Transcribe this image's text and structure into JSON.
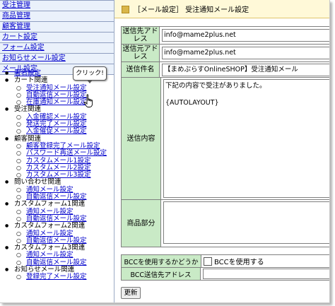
{
  "nav": {
    "items": [
      "受注管理",
      "商品管理",
      "顧客管理",
      "カート設定",
      "フォーム設定",
      "お知らせメール設定",
      "メール設定"
    ]
  },
  "tree": {
    "groups": [
      {
        "label": "署名設定",
        "children": []
      },
      {
        "label": "カート関連",
        "children": [
          "受注通知メール設定",
          "自動返信メール設定",
          "在庫通知メール設定"
        ]
      },
      {
        "label": "受注関連",
        "children": [
          "入金確認メール設定",
          "発送完了メール設定",
          "入金催促メール設定"
        ]
      },
      {
        "label": "顧客関連",
        "children": [
          "顧客登録完了メール設定",
          "パスワード再送メール設定",
          "カスタムメール1設定",
          "カスタムメール2設定",
          "カスタムメール3設定"
        ]
      },
      {
        "label": "問い合わせ関連",
        "children": [
          "通知メール設定",
          "自動返信メール設定"
        ]
      },
      {
        "label": "カスタムフォーム1関連",
        "children": [
          "通知メール設定",
          "自動返信メール設定"
        ]
      },
      {
        "label": "カスタムフォーム2関連",
        "children": [
          "通知メール設定",
          "自動返信メール設定"
        ]
      },
      {
        "label": "カスタムフォーム3関連",
        "children": [
          "通知メール設定",
          "自動返信メール設定"
        ]
      },
      {
        "label": "お知らせメール関連",
        "children": [
          "登録完了メール設定"
        ]
      }
    ]
  },
  "tooltip": {
    "text": "クリック!"
  },
  "header": {
    "title": "［メール設定］ 受注通知メール設定"
  },
  "form": {
    "to_label": "送信先アドレス",
    "to_value": "info@mame2plus.net",
    "from_label": "送信元アドレス",
    "from_value": "info@mame2plus.net",
    "subject_label": "送信件名",
    "subject_value": "【まめぷらすOnlineSHOP】受注通知メール",
    "body_label": "送信内容",
    "body_value": "下記の内容で受注がありました。\n\n{AUTOLAYOUT}",
    "product_label": "商品部分",
    "product_value": "",
    "bcc_use_label": "BCCを使用するかどうか",
    "bcc_use_option": "BCCを使用する",
    "bcc_address_label": "BCC送信先アドレス",
    "bcc_address_value": ""
  },
  "buttons": {
    "update": "更新"
  },
  "colors": {
    "label_bg": "#c9eac6",
    "nav_bg": "#eaf1fb",
    "link": "#0000cc",
    "header_bg": "#fff9d8"
  }
}
